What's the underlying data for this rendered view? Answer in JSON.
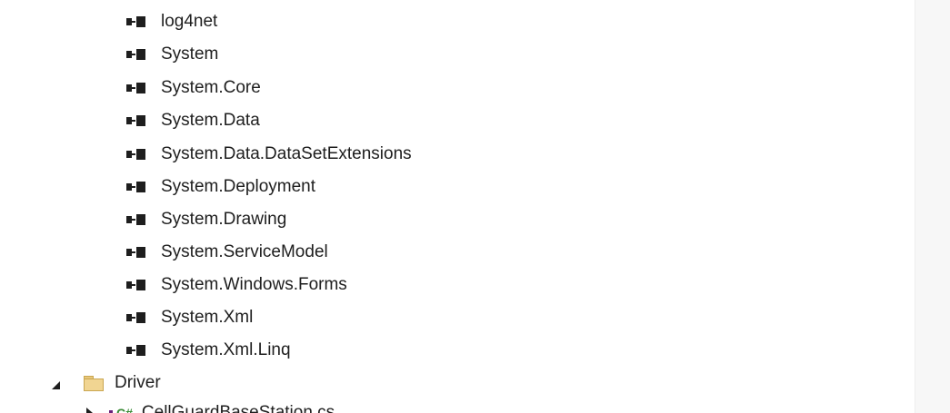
{
  "references": [
    {
      "label": "log4net"
    },
    {
      "label": "System"
    },
    {
      "label": "System.Core"
    },
    {
      "label": "System.Data"
    },
    {
      "label": "System.Data.DataSetExtensions"
    },
    {
      "label": "System.Deployment"
    },
    {
      "label": "System.Drawing"
    },
    {
      "label": "System.ServiceModel"
    },
    {
      "label": "System.Windows.Forms"
    },
    {
      "label": "System.Xml"
    },
    {
      "label": "System.Xml.Linq"
    }
  ],
  "folder": {
    "label": "Driver",
    "expanded": true
  },
  "file": {
    "label": "CellGuardBaseStation.cs",
    "icon": "csharp-file-icon",
    "icon_text": "C#"
  },
  "icons": {
    "reference": "reference-icon",
    "folder": "folder-icon"
  },
  "colors": {
    "background": "#ffffff",
    "text": "#1e1e1e",
    "folder": "#f1d592",
    "csharp": "#388a34"
  }
}
